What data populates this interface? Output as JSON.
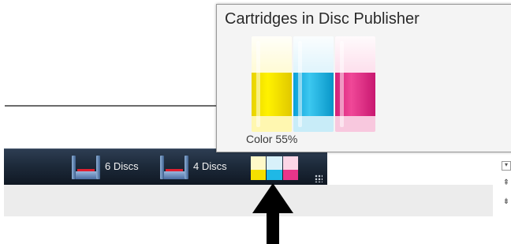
{
  "popup": {
    "title": "Cartridges in Disc Publisher",
    "color_label": "Color 55%",
    "cartridges": [
      {
        "name": "yellow",
        "color": "#f5e000",
        "base": "#fff7b0",
        "level": 0.55
      },
      {
        "name": "cyan",
        "color": "#1fb8e6",
        "base": "#c8ecf8",
        "level": 0.55
      },
      {
        "name": "magenta",
        "color": "#e8358a",
        "base": "#f8c8de",
        "level": 0.55
      }
    ]
  },
  "status_bar": {
    "bins": [
      {
        "label": "6 Discs",
        "icon": "disc-bin-icon"
      },
      {
        "label": "4 Discs",
        "icon": "disc-bin-icon"
      }
    ],
    "background": "#1d2a3a"
  },
  "overlay": {
    "arrow_color": "#000000"
  }
}
